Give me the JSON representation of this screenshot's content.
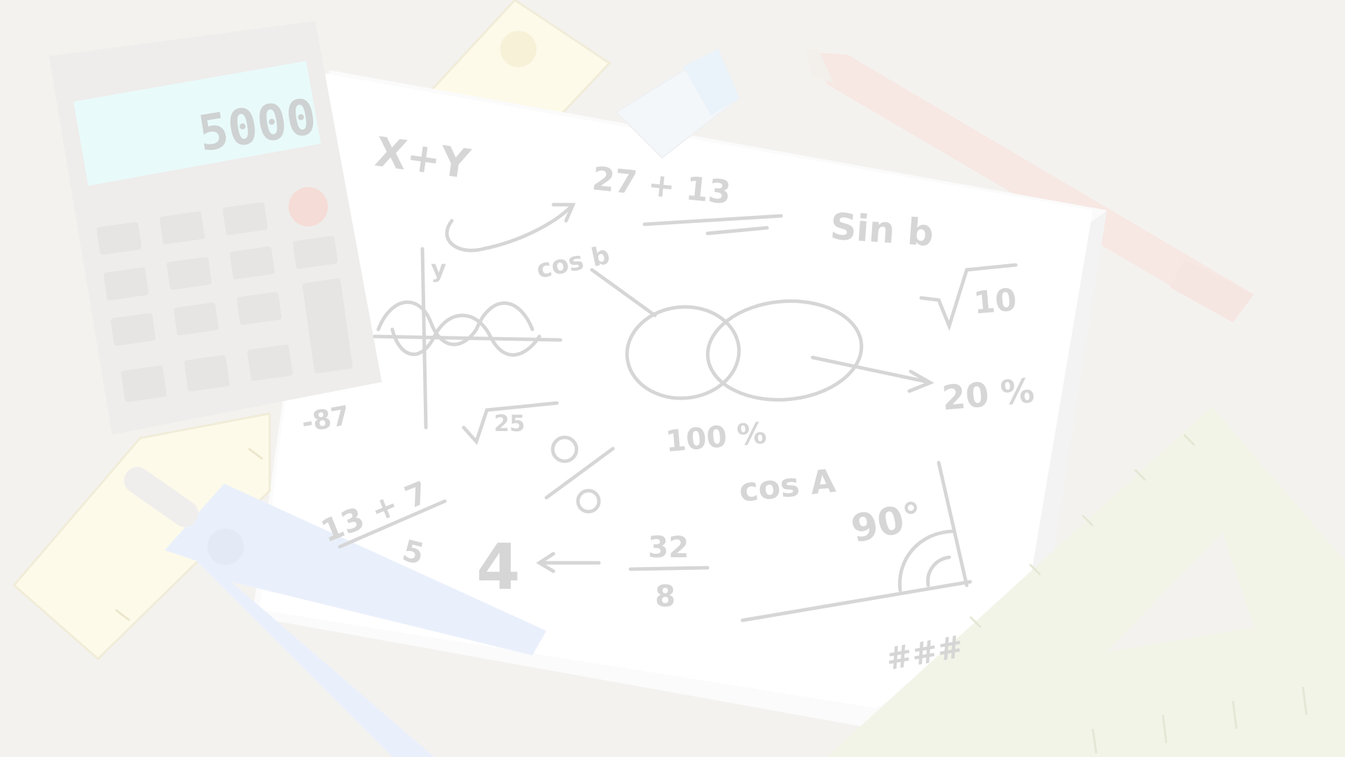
{
  "scene": {
    "description_free": true,
    "colors": {
      "background": "#f4f2ef",
      "paper": "#ffffff",
      "ink": "#d6d6d6",
      "calculator_body": "#eeedeb",
      "calculator_screen": "#e9fafa",
      "calculator_red_button": "#f6dcd6",
      "ruler_yellow": "#fdfaea",
      "pencil": "#f7e8e4",
      "eraser": "#eaf2fa",
      "compass": "#eaf0fb",
      "set_square": "#f2f4e8"
    },
    "calculator": {
      "display": "5000",
      "icon": "calculator-icon"
    },
    "math_notes": {
      "x_plus_y": "X+Y",
      "sum": "27 + 13",
      "sin_b": "Sin b",
      "cos_b": "cos b",
      "y": "y",
      "sqrt_10": "10",
      "percent_20": "20 %",
      "minus_87": "-87",
      "sqrt_25": "25",
      "percent_100": "100 %",
      "cos_a": "cos A",
      "degrees_90": "90°",
      "frac_num": "13 + 7",
      "frac_den": "5",
      "four": "4",
      "frac2_num": "32",
      "frac2_den": "8",
      "hash": "###"
    }
  }
}
